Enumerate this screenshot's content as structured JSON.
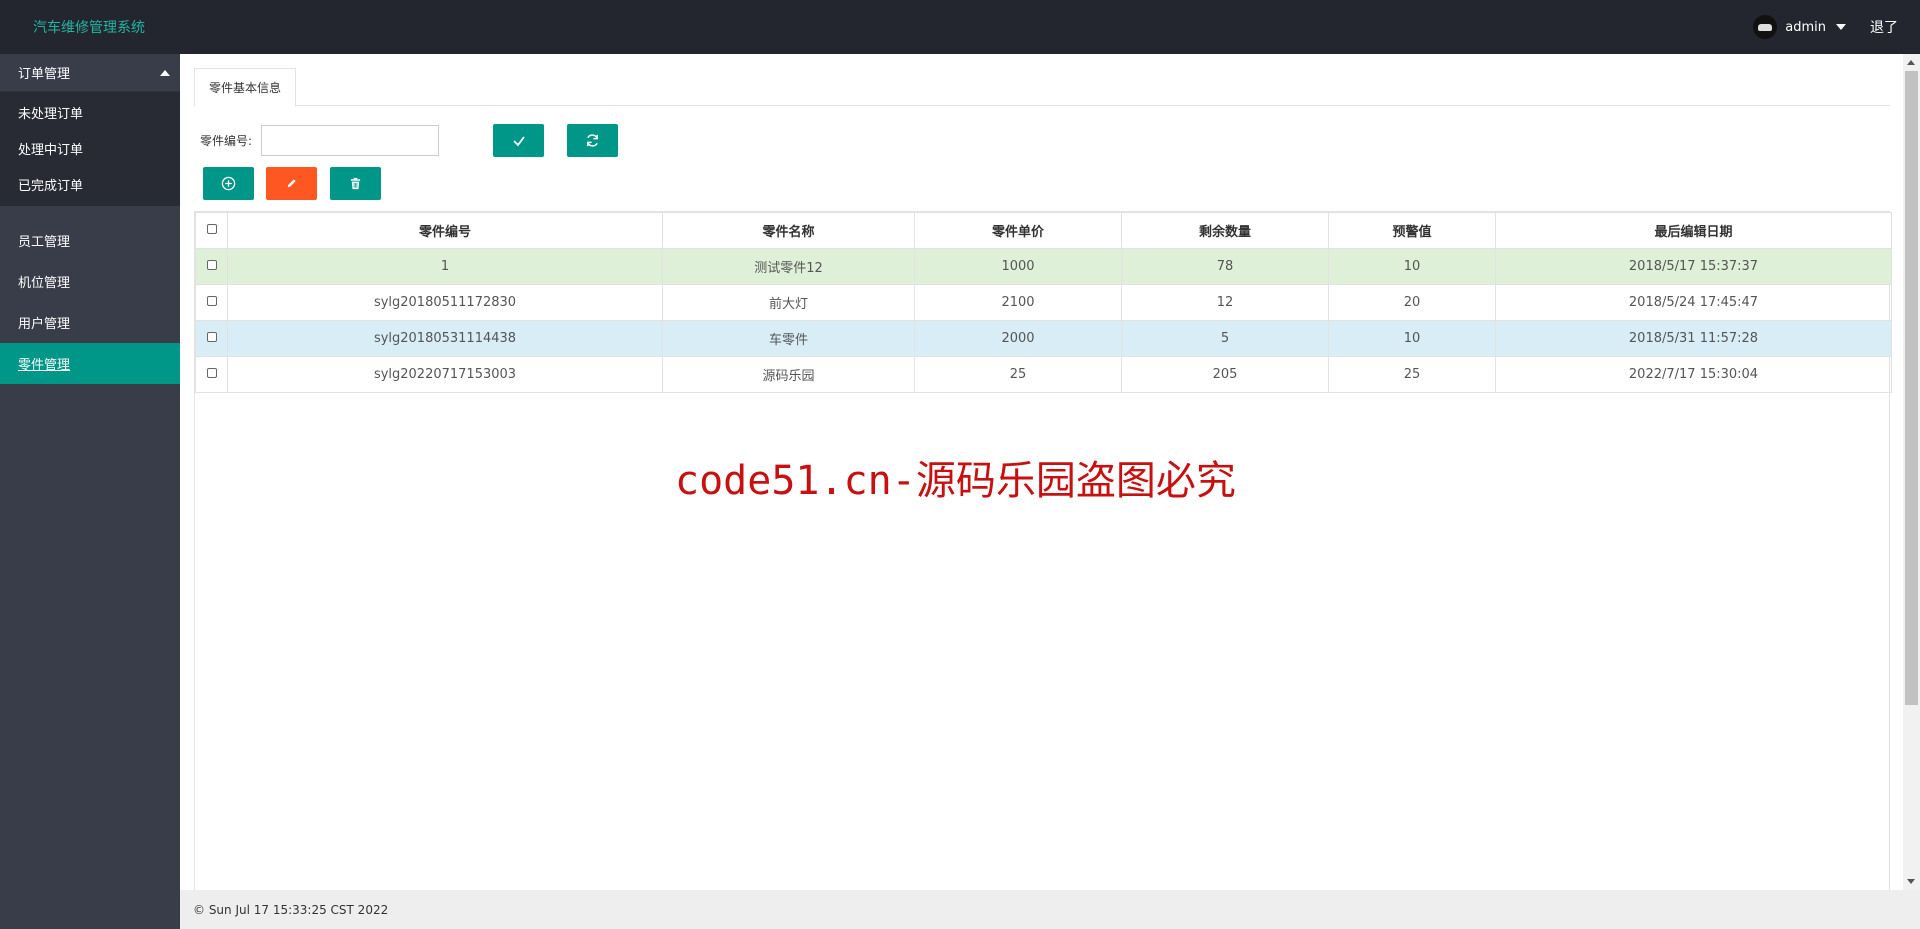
{
  "header": {
    "brand": "汽车维修管理系统",
    "username": "admin",
    "logout_label": "退了"
  },
  "sidebar": {
    "group_title": "订单管理",
    "subitems": [
      {
        "label": "未处理订单"
      },
      {
        "label": "处理中订单"
      },
      {
        "label": "已完成订单"
      }
    ],
    "items": [
      {
        "label": "员工管理"
      },
      {
        "label": "机位管理"
      },
      {
        "label": "用户管理"
      },
      {
        "label": "零件管理",
        "active": true
      }
    ]
  },
  "main": {
    "tab_label": "零件基本信息",
    "search": {
      "label": "零件编号:",
      "value": "",
      "placeholder": ""
    },
    "buttons": {
      "confirm_icon": "check-icon",
      "refresh_icon": "refresh-icon",
      "add_icon": "plus-circle-icon",
      "edit_icon": "pencil-icon",
      "delete_icon": "trash-icon"
    },
    "table": {
      "headers": [
        "零件编号",
        "零件名称",
        "零件单价",
        "剩余数量",
        "预警值",
        "最后编辑日期"
      ],
      "rows": [
        {
          "cells": [
            "1",
            "测试零件12",
            "1000",
            "78",
            "10",
            "2018/5/17 15:37:37"
          ],
          "highlight": "green"
        },
        {
          "cells": [
            "sylg20180511172830",
            "前大灯",
            "2100",
            "12",
            "20",
            "2018/5/24 17:45:47"
          ],
          "highlight": "none"
        },
        {
          "cells": [
            "sylg20180531114438",
            "车零件",
            "2000",
            "5",
            "10",
            "2018/5/31 11:57:28"
          ],
          "highlight": "blue"
        },
        {
          "cells": [
            "sylg20220717153003",
            "源码乐园",
            "25",
            "205",
            "25",
            "2022/7/17 15:30:04"
          ],
          "highlight": "none"
        }
      ]
    },
    "watermark": "code51.cn-源码乐园盗图必究"
  },
  "footer": {
    "text": "© Sun Jul 17 15:33:25 CST 2022"
  },
  "colors": {
    "header_bg": "#23262e",
    "sidebar_bg": "#393d49",
    "accent": "#009688",
    "orange": "#ff5722",
    "watermark": "#c81010"
  }
}
